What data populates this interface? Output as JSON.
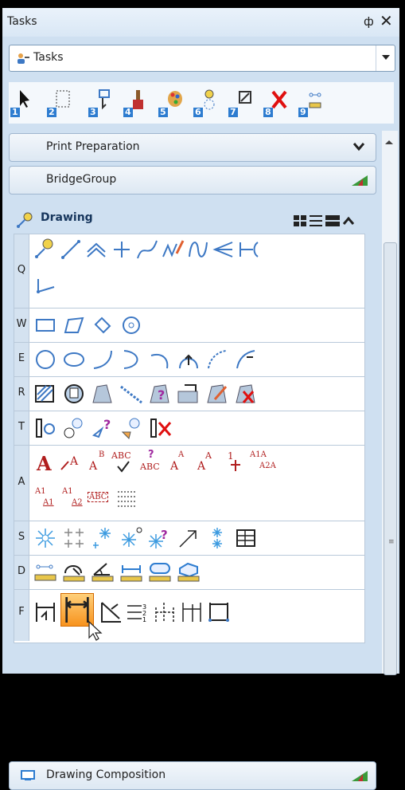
{
  "window": {
    "title": "Tasks",
    "pin_glyph": "ф",
    "close_glyph": "✕"
  },
  "task_selector": {
    "value": "Tasks",
    "icon": "tasks-icon"
  },
  "toolbar": {
    "numbers": [
      "1",
      "2",
      "3",
      "4",
      "5",
      "6",
      "7",
      "8",
      "9"
    ]
  },
  "groups": {
    "print": {
      "label": "Print Preparation",
      "icon": "chevron-down-icon"
    },
    "bridge": {
      "label": "BridgeGroup",
      "icon": "bridge-group-icon"
    },
    "composition": {
      "label": "Drawing Composition",
      "icon": "drawing-composition-icon"
    }
  },
  "drawing": {
    "label": "Drawing",
    "view_modes": [
      "grid-view-icon",
      "list-view-icon",
      "detail-view-icon"
    ],
    "rows": [
      {
        "key": "Q"
      },
      {
        "key": "W"
      },
      {
        "key": "E"
      },
      {
        "key": "R"
      },
      {
        "key": "T"
      },
      {
        "key": "A",
        "text_tools": [
          "A",
          "A",
          "B",
          "ABC",
          "?",
          "A",
          "A",
          "1",
          "A1A",
          "A2A",
          "A1",
          "A1",
          "A1",
          "A2",
          "ABC"
        ]
      },
      {
        "key": "S"
      },
      {
        "key": "D"
      },
      {
        "key": "F"
      }
    ]
  },
  "colors": {
    "accent": "#2d7cd0",
    "panel": "#cfe0f1",
    "selected": "#f7931e"
  }
}
